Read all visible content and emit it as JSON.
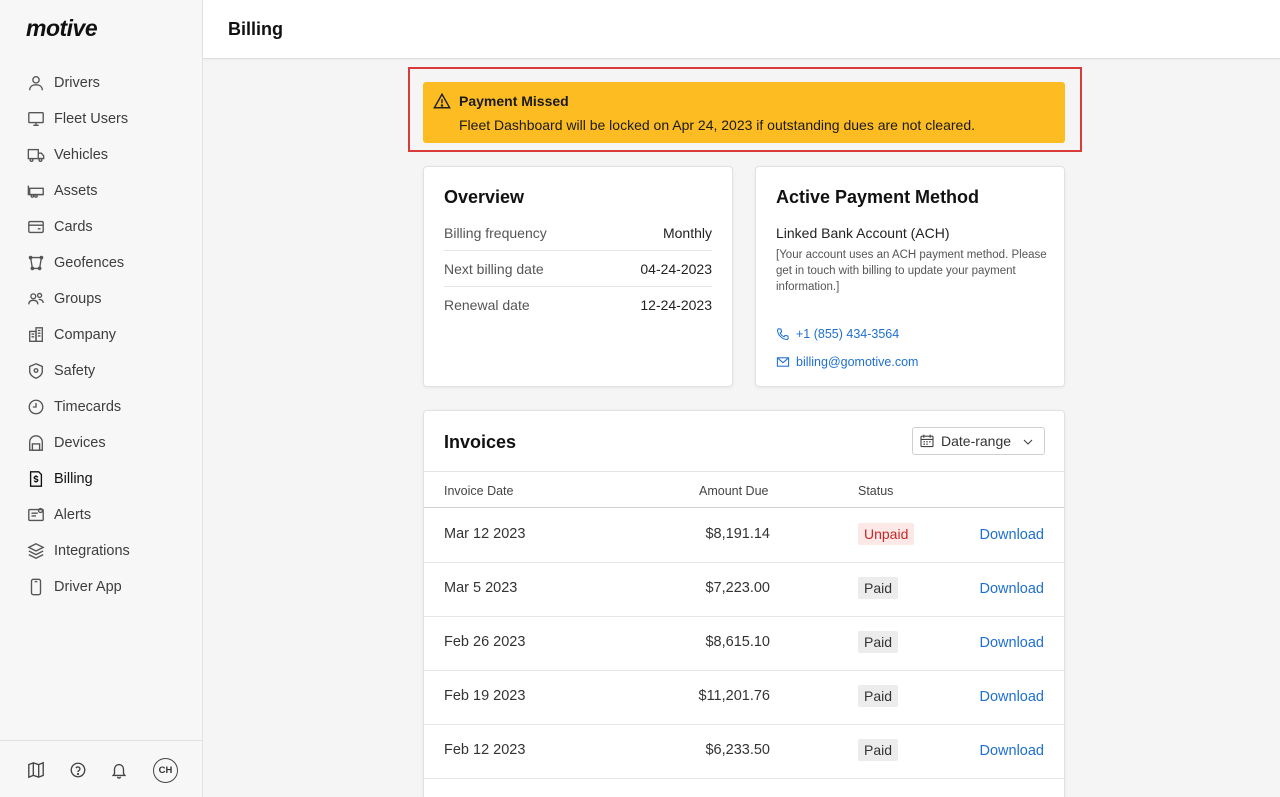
{
  "brand": {
    "logo": "motive"
  },
  "sidebar": {
    "items": [
      {
        "label": "Drivers",
        "icon": "user-icon"
      },
      {
        "label": "Fleet Users",
        "icon": "monitor-icon"
      },
      {
        "label": "Vehicles",
        "icon": "truck-icon"
      },
      {
        "label": "Assets",
        "icon": "trailer-icon"
      },
      {
        "label": "Cards",
        "icon": "card-icon"
      },
      {
        "label": "Geofences",
        "icon": "geofence-icon"
      },
      {
        "label": "Groups",
        "icon": "groups-icon"
      },
      {
        "label": "Company",
        "icon": "building-icon"
      },
      {
        "label": "Safety",
        "icon": "shield-icon"
      },
      {
        "label": "Timecards",
        "icon": "clock-icon"
      },
      {
        "label": "Devices",
        "icon": "device-icon"
      },
      {
        "label": "Billing",
        "icon": "billing-icon",
        "active": true
      },
      {
        "label": "Alerts",
        "icon": "alerts-icon"
      },
      {
        "label": "Integrations",
        "icon": "layers-icon"
      },
      {
        "label": "Driver App",
        "icon": "phone-icon"
      }
    ],
    "footer": {
      "avatar_initials": "CH"
    }
  },
  "header": {
    "title": "Billing"
  },
  "alert": {
    "title": "Payment Missed",
    "message": "Fleet Dashboard will be locked on Apr 24, 2023 if outstanding dues are not cleared.",
    "color": "#fdbd22"
  },
  "overview": {
    "title": "Overview",
    "rows": [
      {
        "label": "Billing frequency",
        "value": "Monthly"
      },
      {
        "label": "Next billing date",
        "value": "04-24-2023"
      },
      {
        "label": "Renewal date",
        "value": "12-24-2023"
      }
    ]
  },
  "payment_method": {
    "title": "Active Payment Method",
    "name": "Linked Bank Account (ACH)",
    "description": "[Your account uses an ACH payment method. Please get in touch with billing to update your payment information.]",
    "phone": "+1 (855) 434-3564",
    "email": "billing@gomotive.com"
  },
  "invoices": {
    "title": "Invoices",
    "date_range_label": "Date-range",
    "columns": {
      "date": "Invoice Date",
      "amount": "Amount Due",
      "status": "Status"
    },
    "download_label": "Download",
    "rows": [
      {
        "date": "Mar 12 2023",
        "amount": "$8,191.14",
        "status": "Unpaid"
      },
      {
        "date": "Mar 5 2023",
        "amount": "$7,223.00",
        "status": "Paid"
      },
      {
        "date": "Feb 26 2023",
        "amount": "$8,615.10",
        "status": "Paid"
      },
      {
        "date": "Feb 19 2023",
        "amount": "$11,201.76",
        "status": "Paid"
      },
      {
        "date": "Feb 12 2023",
        "amount": "$6,233.50",
        "status": "Paid"
      }
    ]
  }
}
